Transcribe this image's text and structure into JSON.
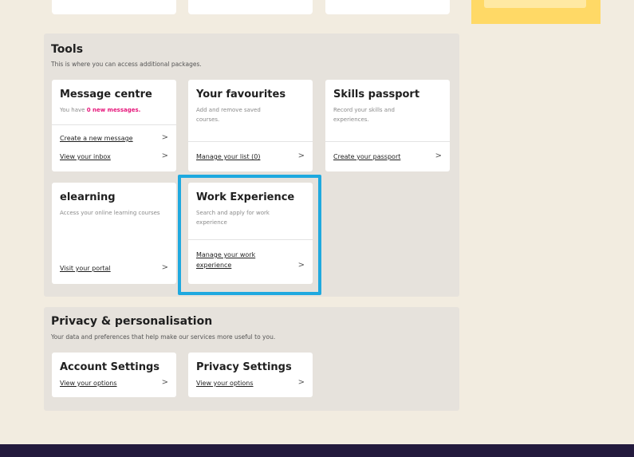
{
  "tools": {
    "title": "Tools",
    "description": "This is where you can access additional packages.",
    "cards": {
      "message_centre": {
        "title": "Message centre",
        "sub_prefix": "You have ",
        "sub_highlight": "0 new messages.",
        "link1": "Create a new message",
        "link2": "View your inbox"
      },
      "favourites": {
        "title": "Your favourites",
        "sub": "Add and remove saved courses.",
        "link": "Manage your list (0)"
      },
      "skills_passport": {
        "title": "Skills passport",
        "sub": "Record your skills and experiences.",
        "link": "Create your passport"
      },
      "elearning": {
        "title": "elearning",
        "sub": "Access your online learning courses",
        "link": "Visit your portal"
      },
      "work_experience": {
        "title": "Work Experience",
        "sub": "Search and apply for work experience",
        "link": "Manage your work experience"
      }
    }
  },
  "privacy": {
    "title": "Privacy & personalisation",
    "description": "Your data and preferences that help make our services more useful to you.",
    "cards": {
      "account": {
        "title": "Account Settings",
        "link": "View your options"
      },
      "privacy_settings": {
        "title": "Privacy Settings",
        "link": "View your options"
      }
    }
  },
  "icons": {
    "chevron": "chevron-right-icon"
  },
  "colors": {
    "background": "#f2ece0",
    "panel": "#e6e2dc",
    "highlight": "#1fa9df",
    "accent_pink": "#e6157a",
    "yellow": "#ffd966",
    "footer": "#231a3d"
  }
}
